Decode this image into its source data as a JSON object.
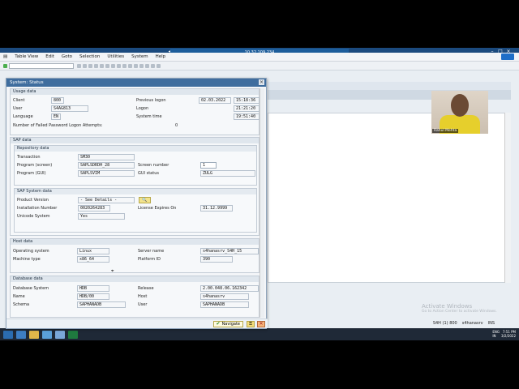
{
  "window": {
    "title": "10.32.109.234"
  },
  "menu": {
    "items": [
      "Table View",
      "Edit",
      "Goto",
      "Selection",
      "Utilities",
      "System",
      "Help"
    ]
  },
  "dialog": {
    "title": "System: Status",
    "usage": {
      "header": "Usage data",
      "client_label": "Client",
      "client_value": "800",
      "user_label": "User",
      "user_value": "S4AG813",
      "language_label": "Language",
      "language_value": "EN",
      "prev_logon_label": "Previous logon",
      "prev_logon_date": "02.03.2022",
      "prev_logon_time": "15:18:36",
      "logon_label": "Logon",
      "logon_time": "21:21:20",
      "system_time_label": "System time",
      "system_time_value": "19:51:40",
      "failed_label": "Number of Failed Password Logon Attempts:",
      "failed_value": "0"
    },
    "sap": {
      "header": "SAP data",
      "repo": {
        "header": "Repository data",
        "transaction_label": "Transaction",
        "transaction_value": "SM30",
        "program_screen_label": "Program (screen)",
        "program_screen_value": "SAPLSDRDH_28",
        "program_gui_label": "Program (GUI)",
        "program_gui_value": "SAPLSVIM",
        "screen_number_label": "Screen number",
        "screen_number_value": "1",
        "gui_status_label": "GUI status",
        "gui_status_value": "ZULG"
      },
      "system": {
        "header": "SAP System data",
        "product_version_label": "Product Version",
        "product_version_value": "- See Details -",
        "installation_label": "Installation Number",
        "installation_value": "0020264283",
        "unicode_label": "Unicode System",
        "unicode_value": "Yes",
        "license_label": "License Expires On",
        "license_value": "31.12.9999"
      }
    },
    "host": {
      "header": "Host data",
      "os_label": "Operating system",
      "os_value": "Linux",
      "machine_label": "Machine type",
      "machine_value": "x86_64",
      "server_label": "Server name",
      "server_value": "s4hanasrv_S4H_15",
      "platform_label": "Platform ID",
      "platform_value": "390"
    },
    "database": {
      "header": "Database data",
      "db_system_label": "Database System",
      "db_system_value": "HDB",
      "name_label": "Name",
      "name_value": "HDB/00",
      "schema_label": "Schema",
      "schema_value": "SAPHANADB",
      "release_label": "Release",
      "release_value": "2.00.048.06.162342",
      "host_label": "Host",
      "host_value": "s4hanasrv",
      "user_label": "User",
      "user_value": "SAPHANADB"
    },
    "footer": {
      "navigate_label": "Navigate"
    }
  },
  "statusbar": {
    "system": "S4H (1) 800",
    "server": "s4hanasrv",
    "mode": "INS"
  },
  "webcam": {
    "name": "Rahul Mehta"
  },
  "watermark": {
    "title": "Activate Windows",
    "subtitle": "Go to Action Center to activate Windows."
  },
  "taskbar": {
    "lang": "ENG",
    "region": "IN",
    "time": "7:51 PM",
    "date": "3/2/2022"
  },
  "colors": {
    "title_bar": "#1b4a7e",
    "dialog_title": "#3f6d9e",
    "taskbar": "#1f2937"
  }
}
